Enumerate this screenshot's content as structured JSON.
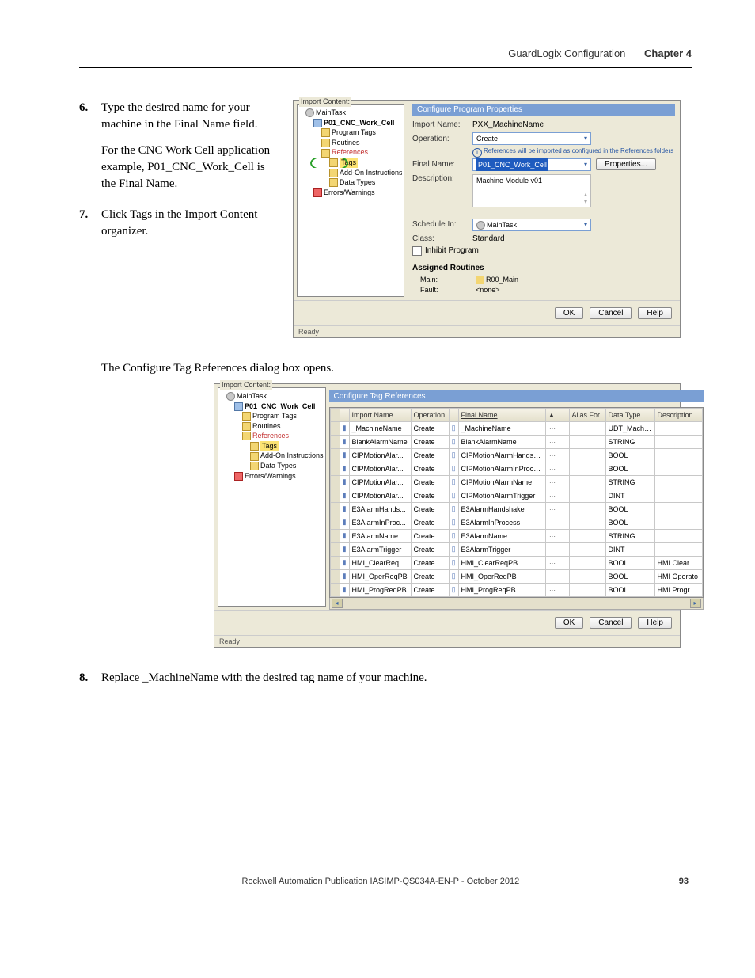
{
  "header": {
    "section": "GuardLogix Configuration",
    "chapter": "Chapter 4"
  },
  "steps": {
    "s6": {
      "num": "6.",
      "p1": "Type the desired name for your machine in the Final Name field.",
      "p2": "For the CNC Work Cell application example, P01_CNC_Work_Cell is the Final Name."
    },
    "s7": {
      "num": "7.",
      "p1": "Click Tags in the Import Content organizer."
    },
    "caption": "The Configure Tag References dialog box opens.",
    "s8": {
      "num": "8.",
      "p1": "Replace _MachineName with the desired tag name of your machine."
    }
  },
  "dialog1": {
    "import_content_label": "Import Content:",
    "tree": {
      "root": "MainTask",
      "prog": "P01_CNC_Work_Cell",
      "ptags": "Program Tags",
      "routines": "Routines",
      "references": "References",
      "tags": "Tags",
      "addon": "Add-On Instructions",
      "dtypes": "Data Types",
      "errors": "Errors/Warnings"
    },
    "title": "Configure Program Properties",
    "import_name_lbl": "Import Name:",
    "import_name": "PXX_MachineName",
    "operation_lbl": "Operation:",
    "operation": "Create",
    "hint": "References will be imported as configured in the References folders",
    "final_name_lbl": "Final Name:",
    "final_name": "P01_CNC_Work_Cell",
    "properties_btn": "Properties...",
    "description_lbl": "Description:",
    "description": "Machine Module v01",
    "schedule_lbl": "Schedule In:",
    "schedule": "MainTask",
    "class_lbl": "Class:",
    "class_val": "Standard",
    "inhibit": "Inhibit Program",
    "assigned": "Assigned Routines",
    "main_lbl": "Main:",
    "main_val": "R00_Main",
    "fault_lbl": "Fault:",
    "fault_val": "<none>",
    "ok": "OK",
    "cancel": "Cancel",
    "help": "Help",
    "ready": "Ready"
  },
  "dialog2": {
    "import_content_label": "Import Content:",
    "tree": {
      "root": "MainTask",
      "prog": "P01_CNC_Work_Cell",
      "ptags": "Program Tags",
      "routines": "Routines",
      "references": "References",
      "tags": "Tags",
      "addon": "Add-On Instructions",
      "dtypes": "Data Types",
      "errors": "Errors/Warnings"
    },
    "title": "Configure Tag References",
    "columns": [
      "",
      "",
      "Import Name",
      "Operation",
      "",
      "Final Name",
      "▲",
      "",
      "Alias For",
      "Data Type",
      "Description"
    ],
    "rows": [
      {
        "imp": "_MachineName",
        "op": "Create",
        "fin": "_MachineName",
        "dt": "UDT_MachCtrl",
        "desc": ""
      },
      {
        "imp": "BlankAlarmName",
        "op": "Create",
        "fin": "BlankAlarmName",
        "dt": "STRING",
        "desc": ""
      },
      {
        "imp": "CIPMotionAlar...",
        "op": "Create",
        "fin": "CIPMotionAlarmHandsh...",
        "dt": "BOOL",
        "desc": ""
      },
      {
        "imp": "CIPMotionAlar...",
        "op": "Create",
        "fin": "CIPMotionAlarmInProcess",
        "dt": "BOOL",
        "desc": ""
      },
      {
        "imp": "CIPMotionAlar...",
        "op": "Create",
        "fin": "CIPMotionAlarmName",
        "dt": "STRING",
        "desc": ""
      },
      {
        "imp": "CIPMotionAlar...",
        "op": "Create",
        "fin": "CIPMotionAlarmTrigger",
        "dt": "DINT",
        "desc": ""
      },
      {
        "imp": "E3AlarmHands...",
        "op": "Create",
        "fin": "E3AlarmHandshake",
        "dt": "BOOL",
        "desc": ""
      },
      {
        "imp": "E3AlarmInProc...",
        "op": "Create",
        "fin": "E3AlarmInProcess",
        "dt": "BOOL",
        "desc": ""
      },
      {
        "imp": "E3AlarmName",
        "op": "Create",
        "fin": "E3AlarmName",
        "dt": "STRING",
        "desc": ""
      },
      {
        "imp": "E3AlarmTrigger",
        "op": "Create",
        "fin": "E3AlarmTrigger",
        "dt": "DINT",
        "desc": ""
      },
      {
        "imp": "HMI_ClearReq...",
        "op": "Create",
        "fin": "HMI_ClearReqPB",
        "dt": "BOOL",
        "desc": "HMI Clear Fa"
      },
      {
        "imp": "HMI_OperReqPB",
        "op": "Create",
        "fin": "HMI_OperReqPB",
        "dt": "BOOL",
        "desc": "HMI Operato"
      },
      {
        "imp": "HMI_ProgReqPB",
        "op": "Create",
        "fin": "HMI_ProgReqPB",
        "dt": "BOOL",
        "desc": "HMI Program"
      }
    ],
    "ok": "OK",
    "cancel": "Cancel",
    "help": "Help",
    "ready": "Ready"
  },
  "footer": {
    "pub": "Rockwell Automation Publication IASIMP-QS034A-EN-P - October 2012",
    "page": "93"
  }
}
